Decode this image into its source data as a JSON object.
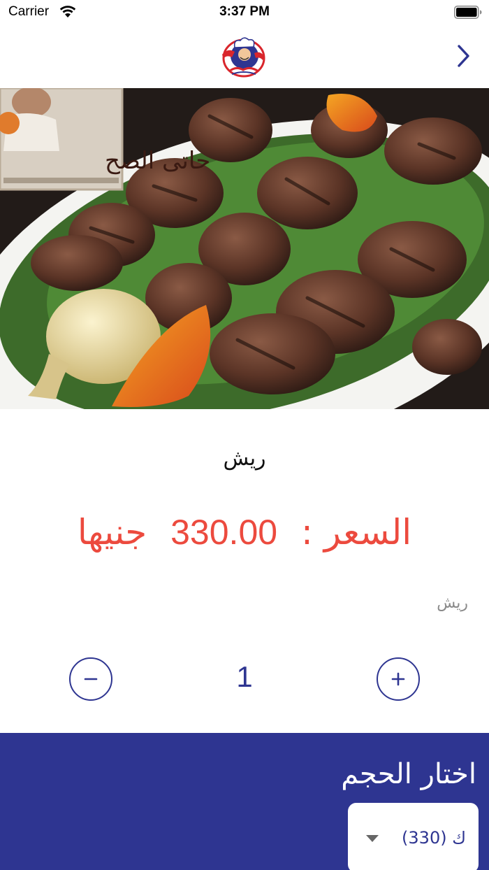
{
  "status_bar": {
    "carrier": "Carrier",
    "time": "3:37 PM"
  },
  "nav": {
    "logo_icon": "restaurant-chef-logo",
    "next_icon": "chevron-right-icon"
  },
  "hero": {
    "image": "grilled-meat-platter-photo",
    "watermark_text": "حاتى الصح"
  },
  "product": {
    "name": "ريش",
    "price_label": "السعر :",
    "price_value": "330.00",
    "price_currency": "جنيها",
    "description": "ريش"
  },
  "quantity": {
    "value": "1",
    "minus_icon": "minus-icon",
    "plus_icon": "plus-icon"
  },
  "size": {
    "title": "اختار الحجم",
    "selected_option": "ك    (330)"
  },
  "colors": {
    "primary": "#2e3591",
    "price": "#ec4a3e"
  }
}
